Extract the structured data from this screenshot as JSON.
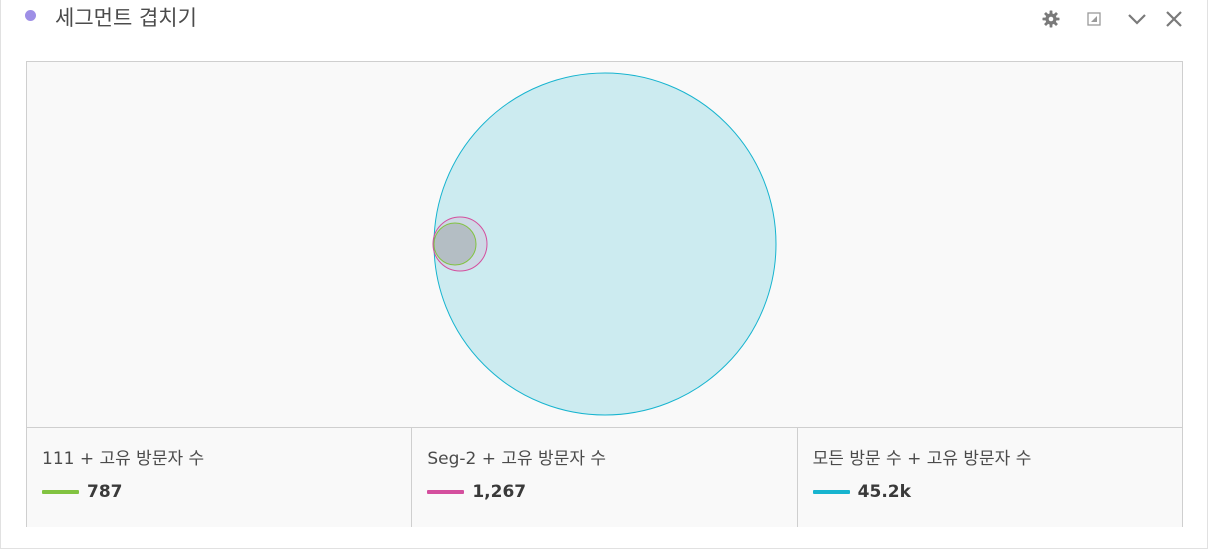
{
  "panel": {
    "title": "세그먼트 겹치기",
    "title_dot_color": "#9e8fe6",
    "icons": [
      "gear-icon",
      "resize-icon",
      "chevron-down-icon",
      "close-icon"
    ]
  },
  "venn": {
    "series": [
      {
        "label": "111 + 고유 방문자 수",
        "value": "787",
        "value_number": 787,
        "color": "#82c341"
      },
      {
        "label": "Seg-2 + 고유 방문자 수",
        "value": "1,267",
        "value_number": 1267,
        "color": "#d44f9e"
      },
      {
        "label": "모든 방문 수 + 고유 방문자 수",
        "value": "45.2k",
        "value_number": 45200,
        "color": "#17b4cf"
      }
    ]
  }
}
